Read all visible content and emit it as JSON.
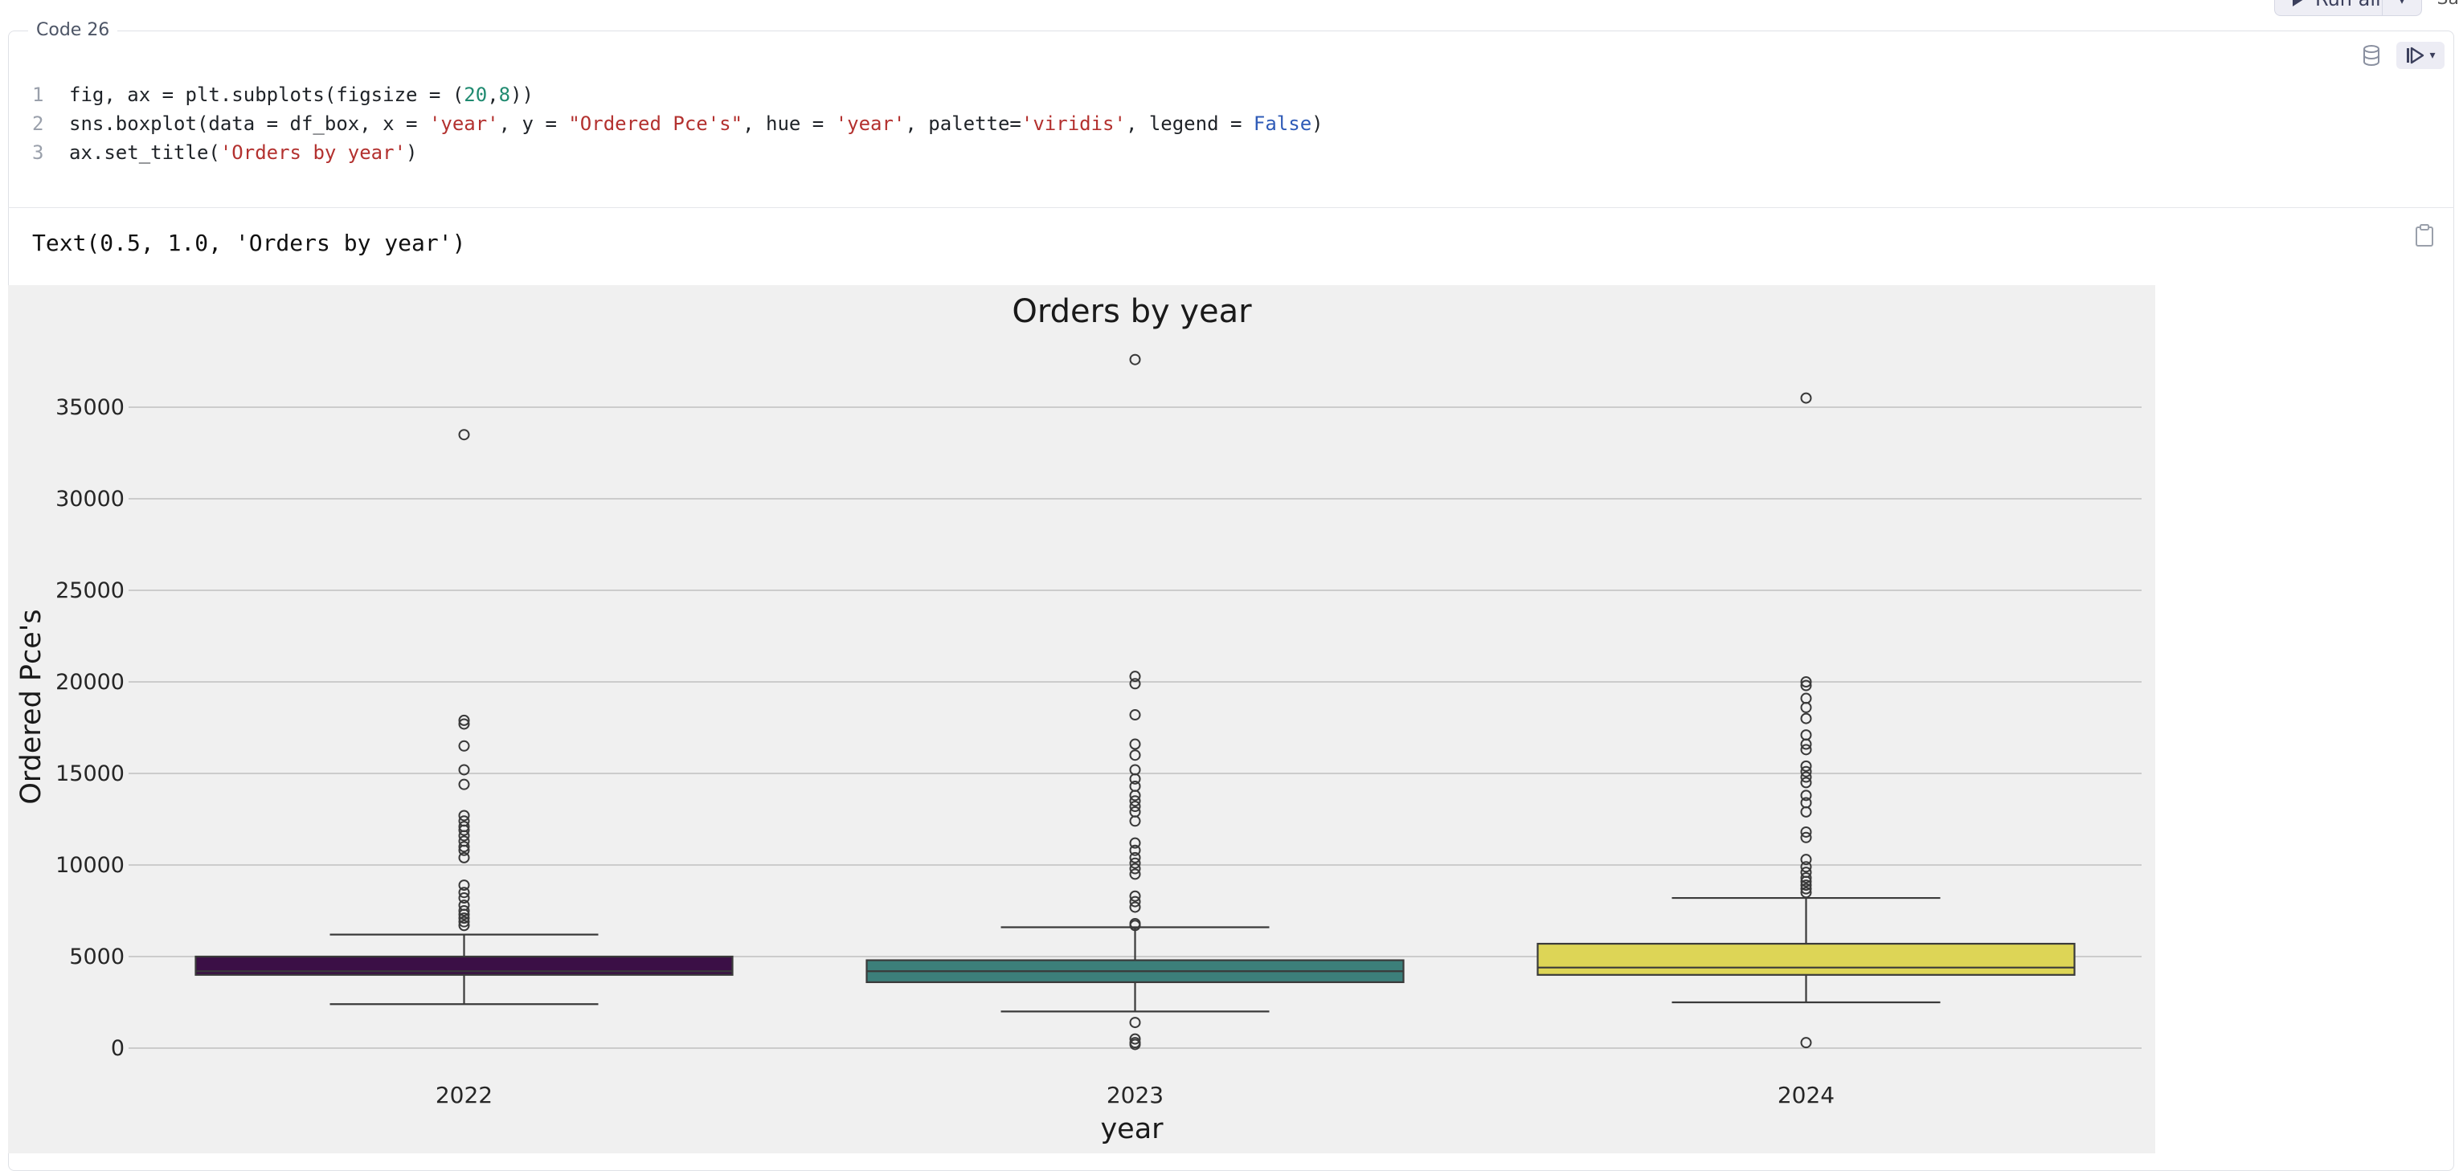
{
  "toolbar": {
    "run_all_label": "Run all",
    "corner_text": "Sa"
  },
  "cell": {
    "label": "Code 26",
    "code_lines": [
      {
        "num": "1",
        "tokens": [
          {
            "t": "fig, ax = plt.subplots(figsize = (",
            "c": ""
          },
          {
            "t": "20",
            "c": "num"
          },
          {
            "t": ",",
            "c": ""
          },
          {
            "t": "8",
            "c": "num"
          },
          {
            "t": "))",
            "c": ""
          }
        ]
      },
      {
        "num": "2",
        "tokens": [
          {
            "t": "sns.boxplot(data = df_box, x = ",
            "c": ""
          },
          {
            "t": "'year'",
            "c": "str"
          },
          {
            "t": ", y = ",
            "c": ""
          },
          {
            "t": "\"Ordered Pce's\"",
            "c": "str"
          },
          {
            "t": ", hue = ",
            "c": ""
          },
          {
            "t": "'year'",
            "c": "str"
          },
          {
            "t": ", palette=",
            "c": ""
          },
          {
            "t": "'viridis'",
            "c": "str"
          },
          {
            "t": ", legend = ",
            "c": ""
          },
          {
            "t": "False",
            "c": "kw"
          },
          {
            "t": ")",
            "c": ""
          }
        ]
      },
      {
        "num": "3",
        "tokens": [
          {
            "t": "ax.set_title(",
            "c": ""
          },
          {
            "t": "'Orders by year'",
            "c": "str"
          },
          {
            "t": ")",
            "c": ""
          }
        ]
      }
    ],
    "output_text": "Text(0.5, 1.0, 'Orders by year')"
  },
  "chart_data": {
    "type": "box",
    "title": "Orders by year",
    "xlabel": "year",
    "ylabel": "Ordered Pce's",
    "ylim": [
      -1500,
      39500
    ],
    "yticks": [
      0,
      5000,
      10000,
      15000,
      20000,
      25000,
      30000,
      35000
    ],
    "grid": "horizontal",
    "categories": [
      "2022",
      "2023",
      "2024"
    ],
    "colors": [
      "#3b0f46",
      "#3c7f7a",
      "#ddd556"
    ],
    "boxes": [
      {
        "q1": 4000,
        "median": 4200,
        "q3": 5000,
        "whislo": 2400,
        "whishi": 6200,
        "fliers": [
          33500,
          17900,
          17700,
          16500,
          15200,
          14400,
          12700,
          12400,
          12100,
          11900,
          11600,
          11300,
          11000,
          10800,
          10400,
          8900,
          8500,
          8200,
          7800,
          7500,
          7300,
          7100,
          6900,
          6700
        ]
      },
      {
        "q1": 3600,
        "median": 4200,
        "q3": 4800,
        "whislo": 2000,
        "whishi": 6600,
        "fliers": [
          37600,
          20300,
          19900,
          18200,
          16600,
          16000,
          15200,
          14700,
          14300,
          13800,
          13500,
          13200,
          12900,
          12400,
          11200,
          10800,
          10400,
          10100,
          9800,
          9500,
          8300,
          8000,
          7700,
          6800,
          6700,
          1400,
          500,
          300,
          200
        ]
      },
      {
        "q1": 4000,
        "median": 4400,
        "q3": 5700,
        "whislo": 2500,
        "whishi": 8200,
        "fliers": [
          35500,
          20000,
          19800,
          19100,
          18600,
          18000,
          17100,
          16600,
          16300,
          15400,
          15100,
          14800,
          14500,
          13800,
          13400,
          12900,
          11800,
          11500,
          10300,
          9900,
          9600,
          9300,
          9100,
          8900,
          8700,
          8500,
          300
        ]
      }
    ]
  }
}
